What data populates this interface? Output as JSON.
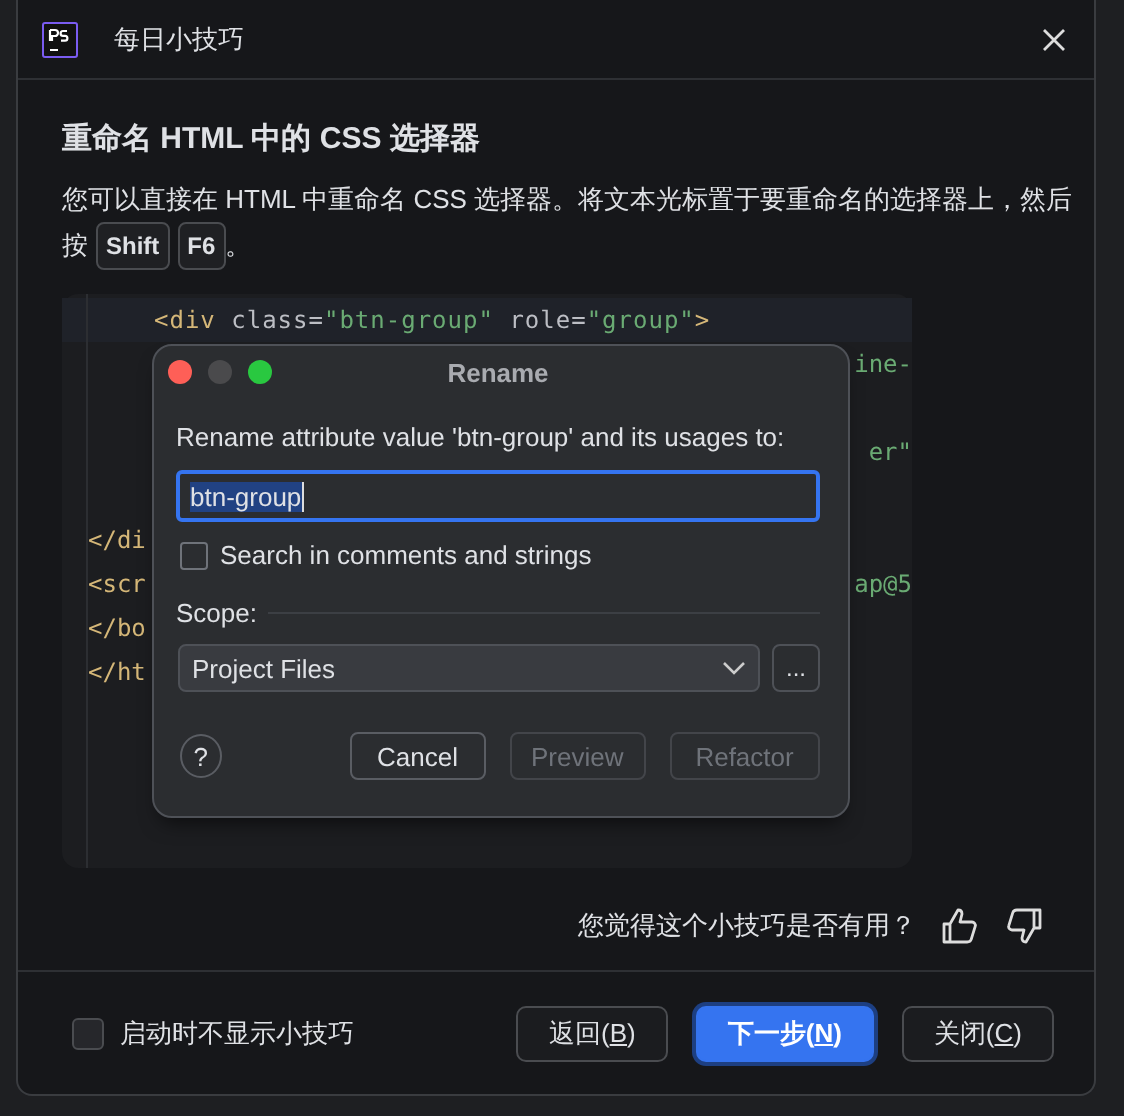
{
  "window": {
    "title": "每日小技巧"
  },
  "tip": {
    "title": "重命名 HTML 中的 CSS 选择器",
    "text": "您可以直接在 HTML 中重命名 CSS 选择器。将文本光标置于要重命名的选择器上，然后",
    "text_2": "按",
    "keys": [
      "Shift",
      "F6"
    ],
    "end": "。"
  },
  "code_lines": [
    {
      "kind": "current",
      "left": [
        {
          "kind": "tag",
          "text": "<div"
        },
        {
          "kind": "attr",
          "text": " class="
        },
        {
          "kind": "string",
          "text": "\"btn-group\""
        },
        {
          "kind": "attr",
          "text": " role="
        },
        {
          "kind": "string",
          "text": "\"group\""
        },
        {
          "kind": "tag",
          "text": ">"
        }
      ]
    },
    {
      "kind": "plain",
      "right": [
        {
          "kind": "string",
          "text": "ine-"
        }
      ]
    },
    {
      "kind": "plain"
    },
    {
      "kind": "plain",
      "right": [
        {
          "kind": "string",
          "text": "er\""
        }
      ]
    },
    {
      "kind": "plain"
    },
    {
      "kind": "plain",
      "left": [
        {
          "kind": "tag",
          "text": "</di"
        }
      ]
    },
    {
      "kind": "plain",
      "left": [
        {
          "kind": "tag",
          "text": "<scr"
        }
      ],
      "right": [
        {
          "kind": "string",
          "text": "ap@5"
        }
      ]
    },
    {
      "kind": "plain",
      "left": [
        {
          "kind": "tag",
          "text": "</bo"
        }
      ]
    },
    {
      "kind": "plain",
      "left": [
        {
          "kind": "tag",
          "text": "</ht"
        }
      ]
    }
  ],
  "rename_dialog": {
    "title": "Rename",
    "prompt": "Rename attribute value 'btn-group' and its usages to:",
    "value": "btn-group",
    "search_checkbox": {
      "label": "Search in comments and strings",
      "checked": false
    },
    "scope_label": "Scope:",
    "scope": "Project Files",
    "more_button": "...",
    "help": "?",
    "buttons": [
      {
        "label": "Cancel",
        "disabled": false
      },
      {
        "label": "Preview",
        "disabled": true
      },
      {
        "label": "Refactor",
        "disabled": true
      }
    ]
  },
  "feedback": {
    "question": "您觉得这个小技巧是否有用？"
  },
  "footer": {
    "checkbox": {
      "label": "启动时不显示小技巧",
      "checked": false
    },
    "buttons": [
      {
        "before": "返回(",
        "key": "B",
        "after": ")",
        "primary": false
      },
      {
        "before": "下一步(",
        "key": "N",
        "after": ")",
        "primary": true
      },
      {
        "before": "关闭(",
        "key": "C",
        "after": ")",
        "primary": false
      }
    ]
  }
}
